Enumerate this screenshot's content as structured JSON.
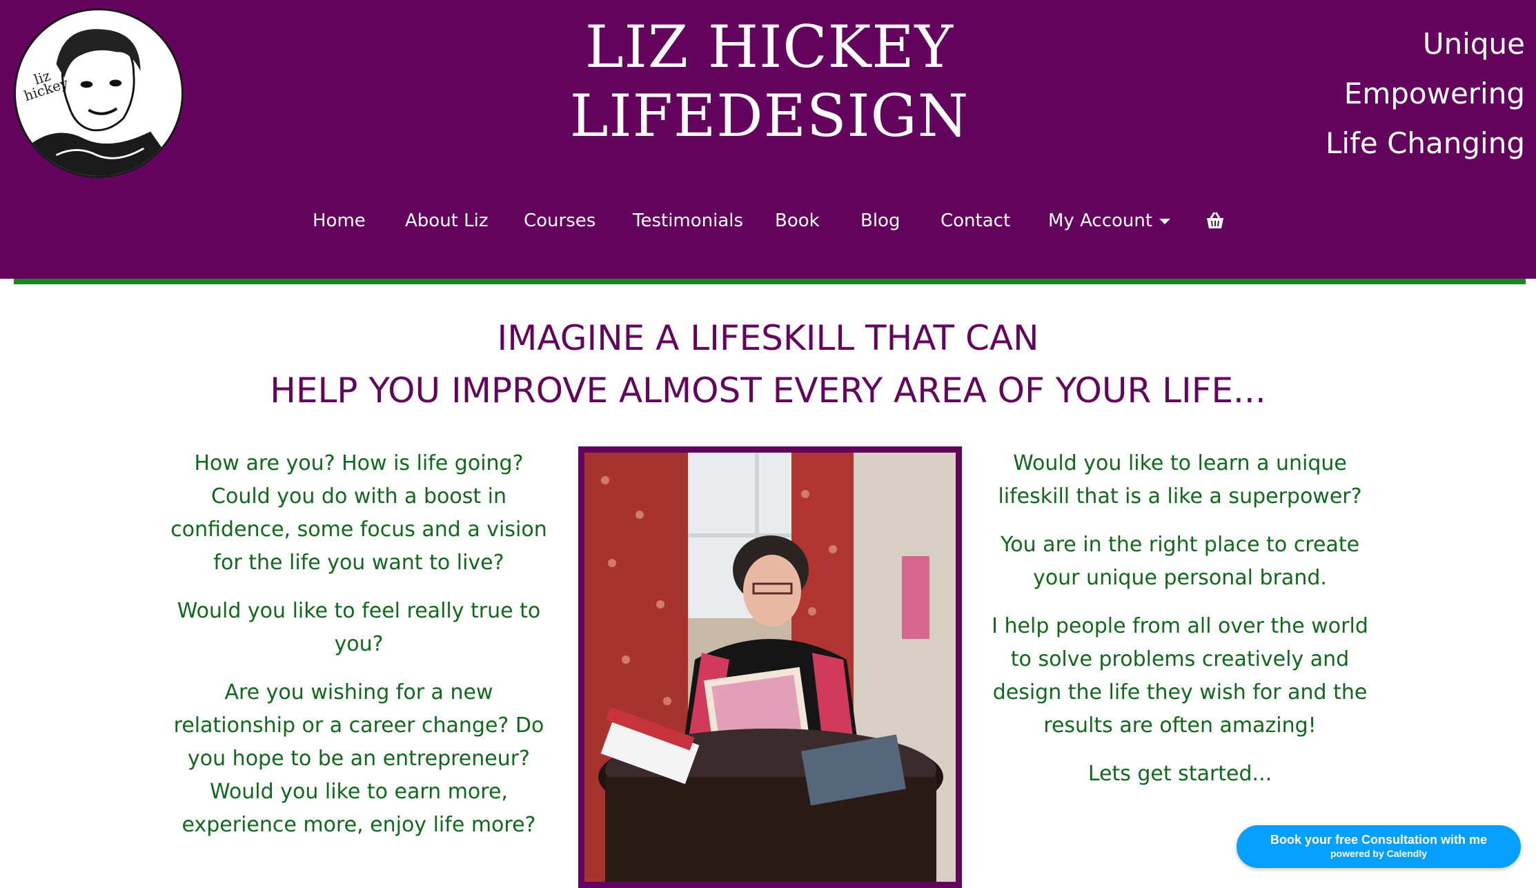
{
  "header": {
    "logo_text": [
      "liz",
      "hickey"
    ],
    "title_lines": [
      "LIZ HICKEY",
      "LIFEDESIGN"
    ],
    "taglines": [
      "Unique",
      "Empowering",
      "Life Changing"
    ]
  },
  "nav": {
    "items": [
      "Home",
      "About Liz",
      "Courses",
      "Testimonials",
      "Book",
      "Blog",
      "Contact",
      "My Account"
    ],
    "cart_icon": "shopping-basket-icon"
  },
  "main": {
    "headline": [
      "IMAGINE A LIFESKILL THAT CAN",
      "HELP YOU IMPROVE ALMOST EVERY AREA OF YOUR LIFE..."
    ],
    "left_paragraphs": [
      "How are you? How is life going? Could you do with a boost in confidence, some focus and a vision for the life you want to live?",
      "Would you like to feel really true to you?",
      "Are you wishing for a new relationship or a career change? Do you hope to be an entrepreneur? Would you like to earn more, experience more, enjoy life more?"
    ],
    "right_paragraphs": [
      "Would you like to learn a unique lifeskill that is a like a superpower?",
      "You are in the right place to create your unique personal brand.",
      "I help people from all over the world to solve problems creatively and design the life they wish for and the results are often amazing!",
      "Lets get started..."
    ]
  },
  "calendly": {
    "label": "Book your free Consultation with me",
    "powered_by": "powered by Calendly"
  },
  "colors": {
    "brand_purple": "#65045f",
    "accent_green": "#158a1c",
    "text_green": "#0e6a1a",
    "calendly_blue": "#05a0ff"
  }
}
